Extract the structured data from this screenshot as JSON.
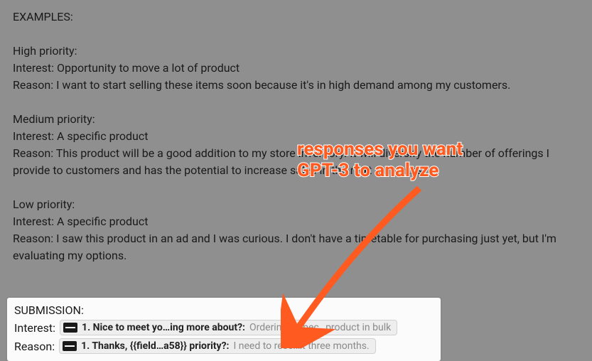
{
  "examples": {
    "header": "EXAMPLES:",
    "high": {
      "title": "High priority:",
      "interest": "Interest: Opportunity to move a lot of product",
      "reason": "Reason: I want to start selling these items soon because it's in high demand among my customers."
    },
    "medium": {
      "title": "Medium priority:",
      "interest": "Interest: A specific product",
      "reason": "Reason: This product will be a good addition to my store inventory. It will diversify the number of offerings I provide to customers and has the potential to increase sales in the next 6 months."
    },
    "low": {
      "title": "Low priority:",
      "interest": "Interest: A specific product",
      "reason": "Reason: I saw this product in an ad and I was curious. I don't have a timetable for purchasing just yet, but I'm evaluating my options."
    }
  },
  "submission": {
    "header": "SUBMISSION:",
    "interest_label": "Interest:",
    "reason_label": "Reason:",
    "interest_pill": {
      "bold": "1. Nice to meet yo…ing more about?: ",
      "grey": "Ordering a spec…product in bulk"
    },
    "reason_pill": {
      "bold": "1. Thanks, {{field…a58}} priority?: ",
      "grey": "I need to recei…t three months."
    }
  },
  "annotation": {
    "line1": "responses you want",
    "line2": "GPT-3 to analyze"
  },
  "colors": {
    "accent": "#ff5a1f"
  }
}
